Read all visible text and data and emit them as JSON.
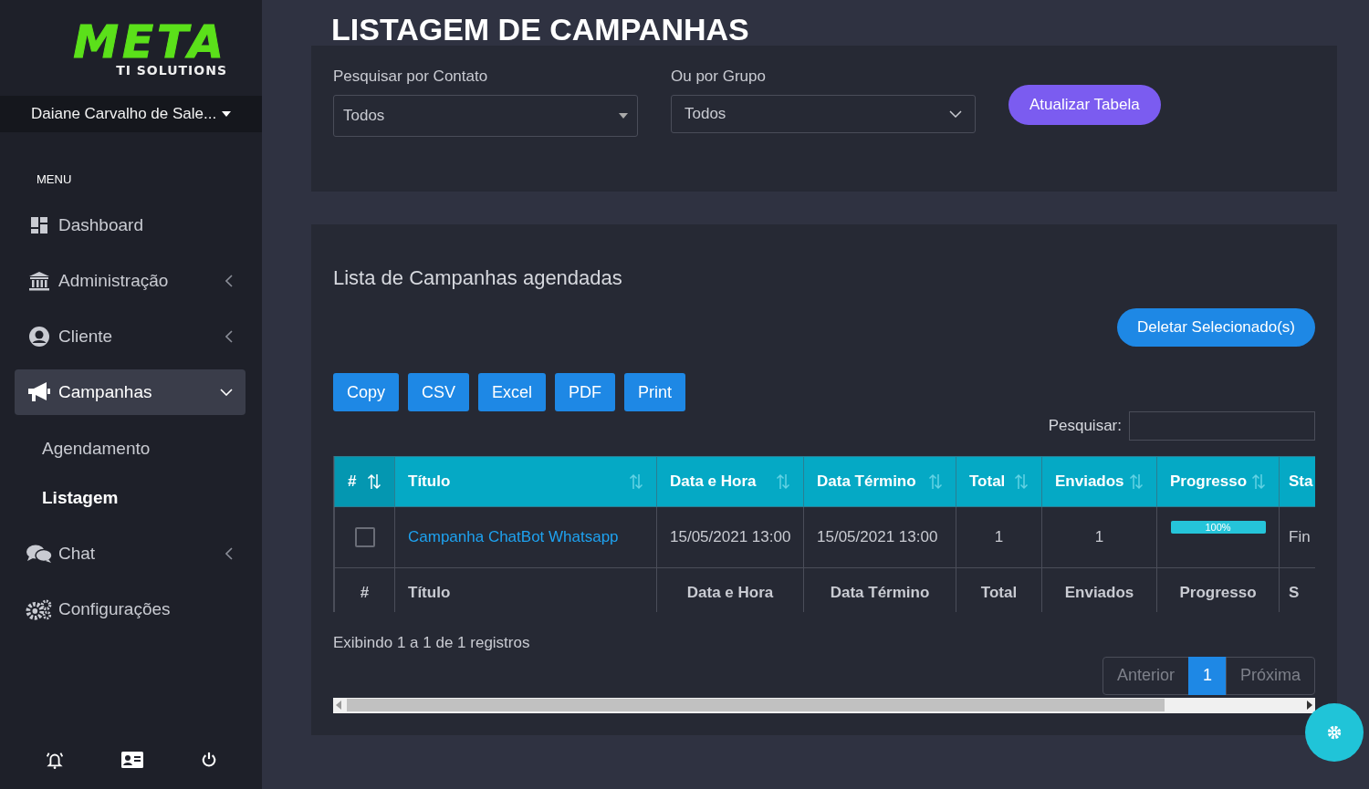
{
  "logo": {
    "wordmark": "META",
    "tagline": "TI SOLUTIONS"
  },
  "user": {
    "name": "Daiane Carvalho de Sale..."
  },
  "sidebar": {
    "heading": "MENU",
    "items": [
      {
        "kind": "link",
        "label": "Dashboard",
        "selected": false
      },
      {
        "kind": "group",
        "label": "Administração",
        "selected": false,
        "expanded": false
      },
      {
        "kind": "group",
        "label": "Cliente",
        "selected": false,
        "expanded": false
      },
      {
        "kind": "group",
        "label": "Campanhas",
        "selected": true,
        "expanded": true,
        "children": [
          {
            "label": "Agendamento",
            "selected": false
          },
          {
            "label": "Listagem",
            "selected": true
          }
        ]
      },
      {
        "kind": "group",
        "label": "Chat",
        "selected": false,
        "expanded": false
      },
      {
        "kind": "link",
        "label": "Configurações",
        "selected": false
      }
    ]
  },
  "page_title": "LISTAGEM DE CAMPANHAS",
  "filters": {
    "contact": {
      "label": "Pesquisar por Contato",
      "value": "Todos"
    },
    "group": {
      "label": "Ou por Grupo",
      "value": "Todos"
    },
    "button": "Atualizar Tabela"
  },
  "list": {
    "title": "Lista de Campanhas agendadas",
    "delete_button": "Deletar Selecionado(s)",
    "export_buttons": [
      "Copy",
      "CSV",
      "Excel",
      "PDF",
      "Print"
    ],
    "search_label": "Pesquisar:",
    "columns": [
      {
        "label": "#",
        "sorted": true
      },
      {
        "label": "Título",
        "sorted": false
      },
      {
        "label": "Data e Hora",
        "sorted": false
      },
      {
        "label": "Data Término",
        "sorted": false
      },
      {
        "label": "Total",
        "sorted": false
      },
      {
        "label": "Enviados",
        "sorted": false
      },
      {
        "label": "Progresso",
        "sorted": false
      },
      {
        "label": "Sta",
        "sorted": false
      }
    ],
    "rows": [
      {
        "checked": false,
        "title": "Campanha ChatBot Whatsapp",
        "start": "15/05/2021 13:00",
        "end": "15/05/2021 13:00",
        "total": "1",
        "sent": "1",
        "level": 1,
        "progress_label": "100%",
        "status": "Fin"
      }
    ],
    "footer_columns": [
      "#",
      "Título",
      "Data e Hora",
      "Data Término",
      "Total",
      "Enviados",
      "Progresso",
      "S"
    ],
    "info": "Exibindo 1 a 1 de 1 registros",
    "pagination": [
      {
        "label": "Anterior",
        "selected": false
      },
      {
        "label": "1",
        "selected": true
      },
      {
        "label": "Próxima",
        "selected": false
      }
    ]
  }
}
